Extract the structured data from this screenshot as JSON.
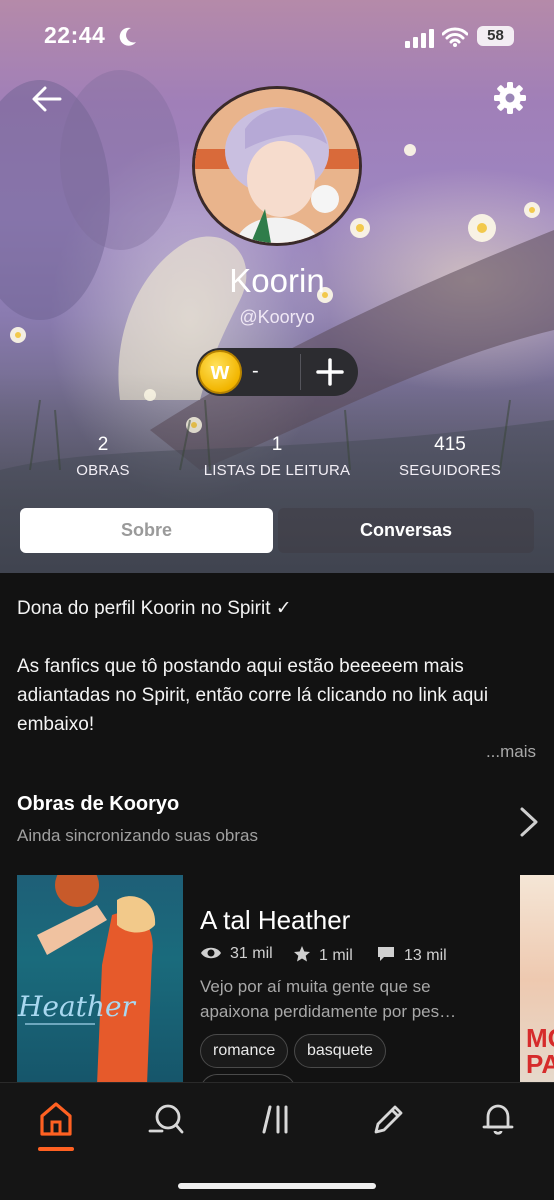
{
  "status_bar": {
    "time": "22:44",
    "battery": "58"
  },
  "profile": {
    "display_name": "Koorin",
    "handle": "@Kooryo",
    "coin_value": "-",
    "coin_symbol": "w"
  },
  "stats": [
    {
      "value": "2",
      "label": "OBRAS"
    },
    {
      "value": "1",
      "label": "LISTAS DE LEITURA"
    },
    {
      "value": "415",
      "label": "SEGUIDORES"
    }
  ],
  "tabs": [
    {
      "label": "Sobre",
      "selected": true
    },
    {
      "label": "Conversas",
      "selected": false
    }
  ],
  "bio": {
    "line1": "Dona do perfil Koorin no Spirit ✓",
    "line2": "As fanfics que tô postando aqui estão beeeeem mais adiantadas no Spirit, então corre lá clicando no link aqui embaixo!",
    "more": "...mais"
  },
  "works": {
    "title": "Obras de Kooryo",
    "subtitle": "Ainda sincronizando suas obras",
    "items": [
      {
        "title": "A tal Heather",
        "cover_title": "Heather",
        "reads": "31 mil",
        "votes": "1 mil",
        "comments": "13 mil",
        "description": "Vejo por aí muita gente que se apaixona perdidamente por pes…",
        "tags": [
          "romance",
          "basquete"
        ]
      }
    ]
  },
  "nav": [
    {
      "name": "home",
      "active": true
    },
    {
      "name": "discover",
      "active": false
    },
    {
      "name": "library",
      "active": false
    },
    {
      "name": "write",
      "active": false
    },
    {
      "name": "notifications",
      "active": false
    }
  ],
  "colors": {
    "accent": "#ff6122",
    "background": "#121212"
  }
}
